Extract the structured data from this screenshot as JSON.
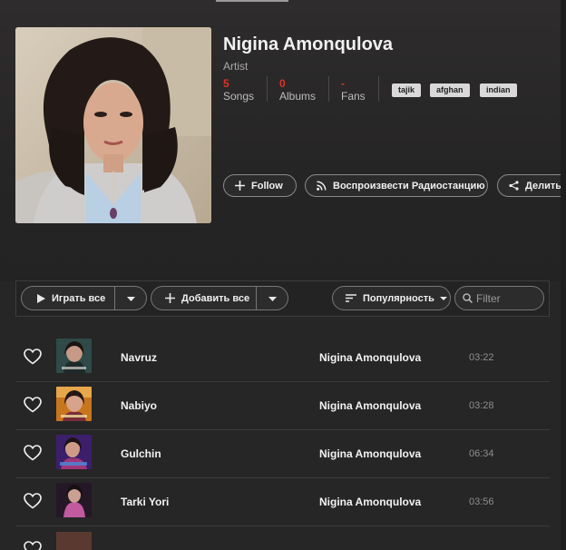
{
  "artist": {
    "name": "Nigina Amonqulova",
    "role": "Artist",
    "stats": [
      {
        "value": "5",
        "label": "Songs"
      },
      {
        "value": "0",
        "label": "Albums"
      },
      {
        "value": "-",
        "label": "Fans"
      }
    ],
    "tags": [
      "tajik",
      "afghan",
      "indian"
    ]
  },
  "actions": {
    "follow": "Follow",
    "radio": "Воспроизвести Радиостанцию",
    "share": "Делиться"
  },
  "toolbar": {
    "play_all": "Играть все",
    "add_all": "Добавить все",
    "sort": "Популярность",
    "filter_placeholder": "Filter"
  },
  "songs": [
    {
      "title": "Navruz",
      "artist": "Nigina Amonqulova",
      "duration": "03:22"
    },
    {
      "title": "Nabiyo",
      "artist": "Nigina Amonqulova",
      "duration": "03:28"
    },
    {
      "title": "Gulchin",
      "artist": "Nigina Amonqulova",
      "duration": "06:34"
    },
    {
      "title": "Tarki Yori",
      "artist": "Nigina Amonqulova",
      "duration": "03:56"
    }
  ],
  "colors": {
    "accent": "#e0312b",
    "background": "#262626",
    "tag": "#d9d9d9"
  }
}
